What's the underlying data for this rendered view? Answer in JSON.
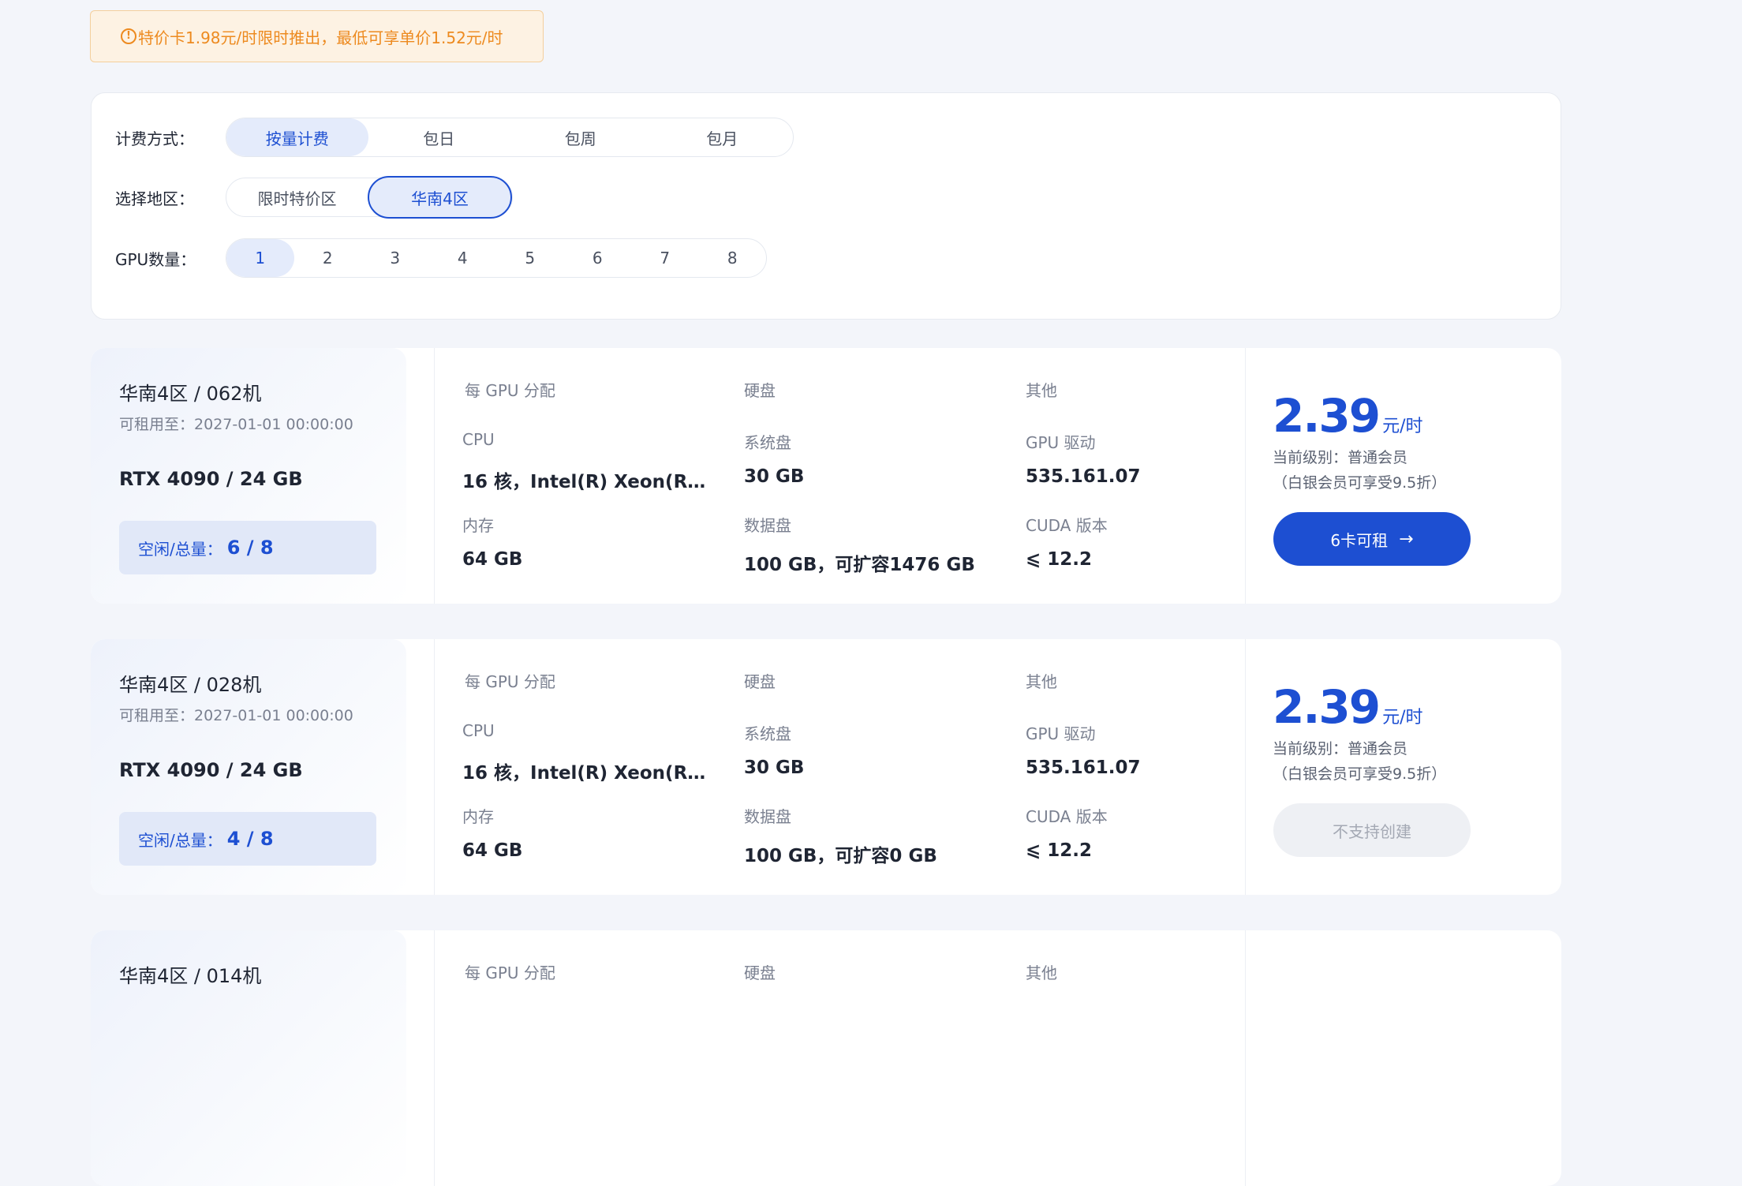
{
  "notice": {
    "icon": "info-icon",
    "text": "特价卡1.98元/时限时推出，最低可享单价1.52元/时"
  },
  "filters": {
    "billing": {
      "label": "计费方式：",
      "options": [
        "按量计费",
        "包日",
        "包周",
        "包月"
      ],
      "selected": "按量计费"
    },
    "region": {
      "label": "选择地区：",
      "options": [
        "限时特价区",
        "华南4区"
      ],
      "selected": "华南4区"
    },
    "gpu_count": {
      "label": "GPU数量：",
      "options": [
        "1",
        "2",
        "3",
        "4",
        "5",
        "6",
        "7",
        "8"
      ],
      "selected": "1"
    }
  },
  "column_headers": {
    "per_gpu": "每 GPU 分配",
    "disk": "硬盘",
    "other": "其他"
  },
  "spec_labels": {
    "cpu": "CPU",
    "memory": "内存",
    "system_disk": "系统盘",
    "data_disk": "数据盘",
    "gpu_driver": "GPU 驱动",
    "cuda": "CUDA 版本"
  },
  "common": {
    "until_label": "可租用至：",
    "idle_label": "空闲/总量：",
    "price_unit": "元/时",
    "level": "当前级别：普通会员",
    "discount": "（白银会员可享受9.5折）"
  },
  "machines": [
    {
      "title": "华南4区 / 062机",
      "until": "2027-01-01 00:00:00",
      "gpu": "RTX 4090 / 24 GB",
      "idle": "6 / 8",
      "cpu": "16 核，Intel(R) Xeon(R…",
      "memory": "64 GB",
      "system_disk": "30 GB",
      "data_disk": "100 GB，可扩容1476 GB",
      "gpu_driver": "535.161.07",
      "cuda": "⩽ 12.2",
      "price": "2.39",
      "button": "6卡可租",
      "button_enabled": true
    },
    {
      "title": "华南4区 / 028机",
      "until": "2027-01-01 00:00:00",
      "gpu": "RTX 4090 / 24 GB",
      "idle": "4 / 8",
      "cpu": "16 核，Intel(R) Xeon(R…",
      "memory": "64 GB",
      "system_disk": "30 GB",
      "data_disk": "100 GB，可扩容0 GB",
      "gpu_driver": "535.161.07",
      "cuda": "⩽ 12.2",
      "price": "2.39",
      "button": "不支持创建",
      "button_enabled": false
    },
    {
      "title": "华南4区 / 014机"
    }
  ]
}
